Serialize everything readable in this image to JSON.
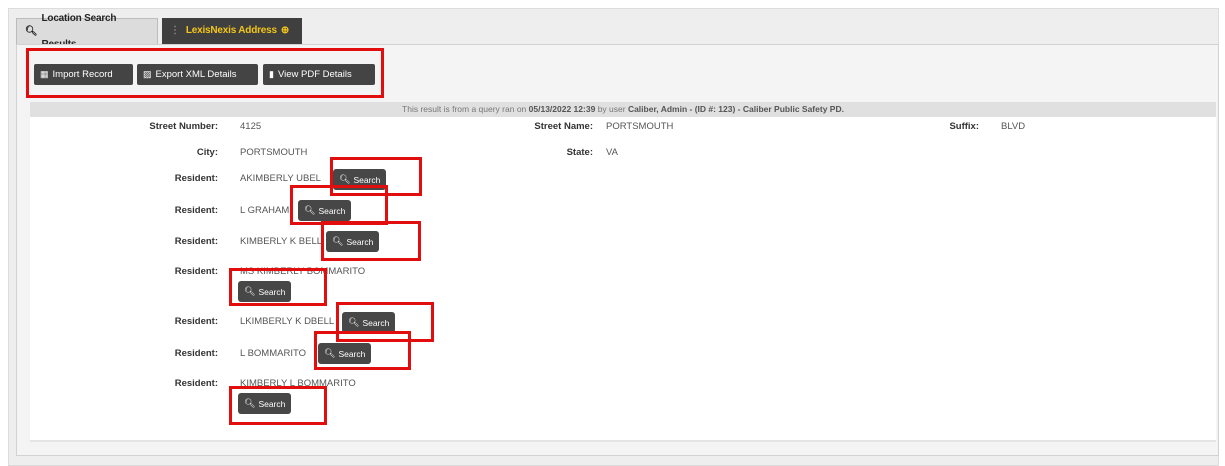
{
  "tabs": [
    {
      "label": "Location Search Results",
      "icon": "search-icon"
    },
    {
      "label": "LexisNexis Address",
      "icon": "plus-circle-icon"
    }
  ],
  "toolbar": {
    "import_label": "Import Record",
    "export_label": "Export XML Details",
    "pdf_label": "View PDF Details"
  },
  "notice": {
    "prefix": "This result is from a query ran on",
    "datetime": "05/13/2022 12:39",
    "by_user": "by user",
    "user": "Caliber, Admin - (ID #: 123) - Caliber Public Safety PD."
  },
  "fields": {
    "street_number_label": "Street Number:",
    "street_number": "4125",
    "street_name_label": "Street Name:",
    "street_name": "PORTSMOUTH",
    "suffix_label": "Suffix:",
    "suffix": "BLVD",
    "city_label": "City:",
    "city": "PORTSMOUTH",
    "state_label": "State:",
    "state": "VA"
  },
  "resident_label": "Resident:",
  "search_label": "Search",
  "residents": [
    "AKIMBERLY UBEL",
    "L GRAHAM",
    "KIMBERLY K BELL",
    "MS KIMBERLY BOMMARITO",
    "LKIMBERLY K DBELL",
    "L BOMMARITO",
    "KIMBERLY L BOMMARITO"
  ],
  "colors": {
    "highlight": "#e20d0d",
    "active_tab_text": "#f3c61a",
    "button_bg": "#474747"
  }
}
